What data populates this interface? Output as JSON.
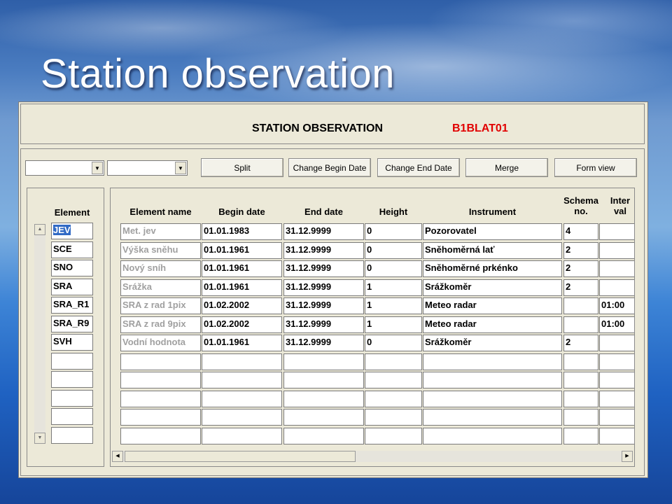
{
  "slide": {
    "title": "Station observation"
  },
  "form": {
    "title": "STATION OBSERVATION",
    "station_code": "B1BLAT01"
  },
  "toolbar": {
    "combo1_value": "",
    "combo2_value": "",
    "buttons": [
      "Split",
      "Change Begin Date",
      "Change End Date",
      "Merge",
      "Form view"
    ]
  },
  "element_column": {
    "header": "Element",
    "values": [
      "JEV",
      "SCE",
      "SNO",
      "SRA",
      "SRA_R1",
      "SRA_R9",
      "SVH",
      "",
      "",
      "",
      "",
      ""
    ]
  },
  "grid": {
    "headers": [
      "Element name",
      "Begin date",
      "End date",
      "Height",
      "Instrument",
      "Schema\nno.",
      "Inter\nval"
    ],
    "rows": [
      [
        "Met. jev",
        "01.01.1983",
        "31.12.9999",
        "0",
        "Pozorovatel",
        "4",
        ""
      ],
      [
        "Výška sněhu",
        "01.01.1961",
        "31.12.9999",
        "0",
        "Sněhoměrná lať",
        "2",
        ""
      ],
      [
        "Nový sníh",
        "01.01.1961",
        "31.12.9999",
        "0",
        "Sněhoměrné prkénko",
        "2",
        ""
      ],
      [
        "Srážka",
        "01.01.1961",
        "31.12.9999",
        "1",
        "Srážkoměr",
        "2",
        ""
      ],
      [
        "SRA z rad 1pix",
        "01.02.2002",
        "31.12.9999",
        "1",
        "Meteo radar",
        "",
        "01:00"
      ],
      [
        "SRA z rad 9pix",
        "01.02.2002",
        "31.12.9999",
        "1",
        "Meteo radar",
        "",
        "01:00"
      ],
      [
        "Vodní hodnota",
        "01.01.1961",
        "31.12.9999",
        "0",
        "Srážkoměr",
        "2",
        ""
      ],
      [
        "",
        "",
        "",
        "",
        "",
        "",
        ""
      ],
      [
        "",
        "",
        "",
        "",
        "",
        "",
        ""
      ],
      [
        "",
        "",
        "",
        "",
        "",
        "",
        ""
      ],
      [
        "",
        "",
        "",
        "",
        "",
        "",
        ""
      ],
      [
        "",
        "",
        "",
        "",
        "",
        "",
        ""
      ]
    ]
  },
  "colors": {
    "station_code": "#e10000",
    "selection": "#316ac5",
    "muted_text": "#a0a0a0"
  }
}
